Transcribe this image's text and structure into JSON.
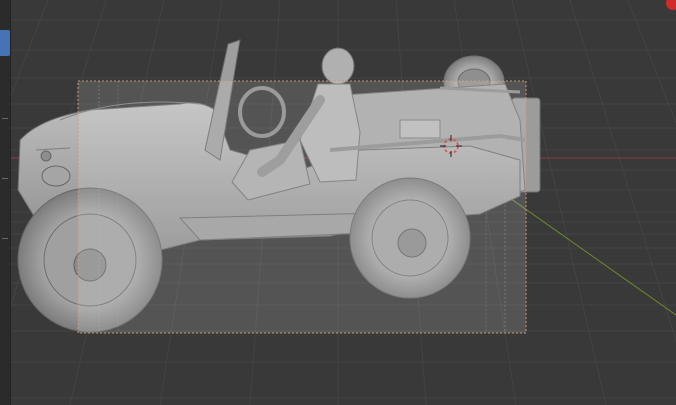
{
  "viewport": {
    "mode": "camera-view-3d",
    "icons": {
      "camera_frame": "camera-frame-icon",
      "cursor_3d": "3d-cursor-icon",
      "toolbar_tab": "active-tool-tab"
    },
    "colors": {
      "background": "#393939",
      "grid_line": "#474747",
      "x_axis": "#8a3b42",
      "y_axis": "#6b8a2a",
      "camera_frame": "#c99a6e",
      "cursor": "#e05050",
      "active_tab": "#4772b3",
      "model": "#a9a9a9"
    },
    "object": "jeep-with-driver-mesh"
  }
}
